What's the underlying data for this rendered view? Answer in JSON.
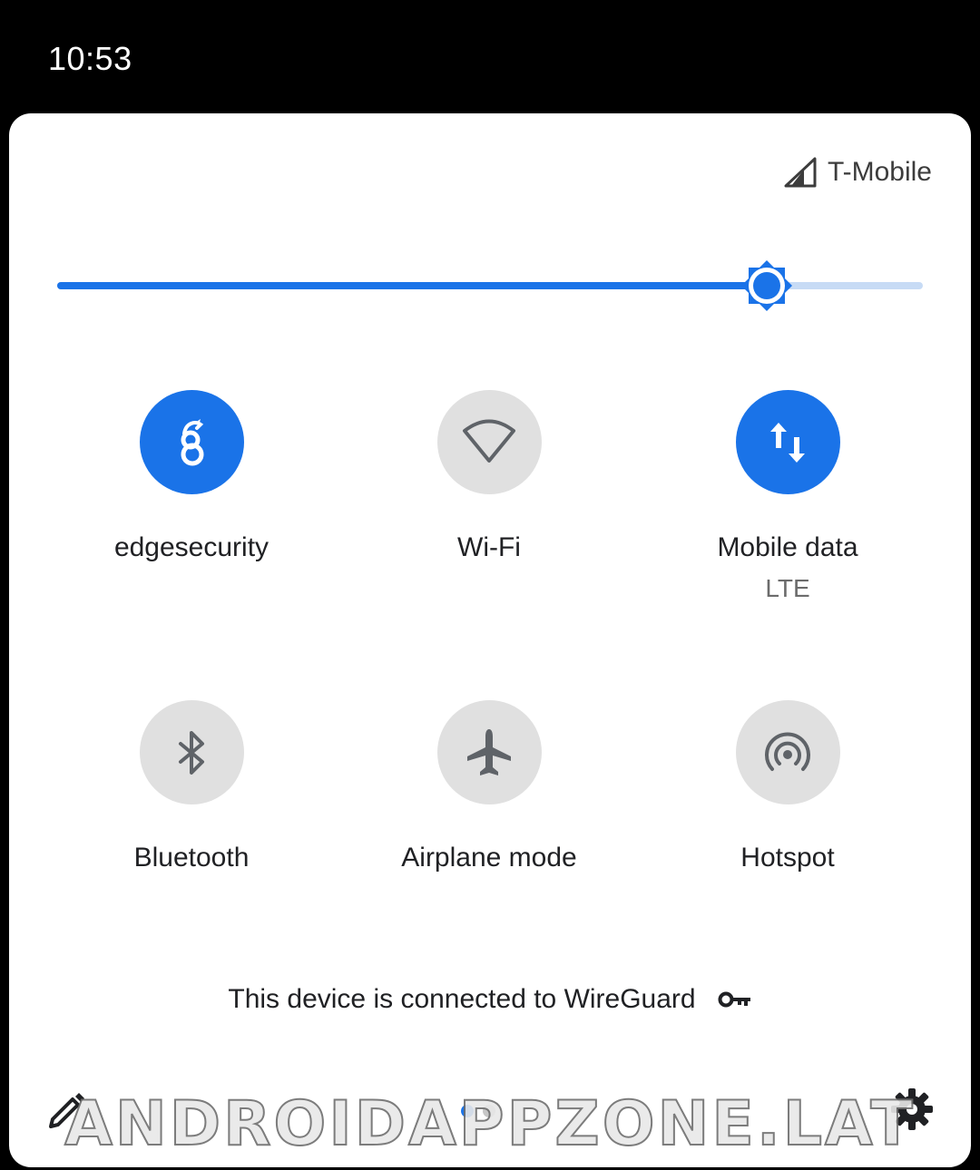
{
  "status_bar": {
    "time": "10:53"
  },
  "panel": {
    "carrier": "T-Mobile",
    "brightness": {
      "level_fraction": 0.82
    }
  },
  "tiles": [
    {
      "label": "edgesecurity",
      "state": "on",
      "icon": "wireguard-icon"
    },
    {
      "label": "Wi-Fi",
      "state": "off",
      "icon": "wifi-icon"
    },
    {
      "label": "Mobile data",
      "sublabel": "LTE",
      "state": "on",
      "icon": "mobile-data-icon"
    },
    {
      "label": "Bluetooth",
      "state": "off",
      "icon": "bluetooth-icon"
    },
    {
      "label": "Airplane mode",
      "state": "off",
      "icon": "airplane-icon"
    },
    {
      "label": "Hotspot",
      "state": "off",
      "icon": "hotspot-icon"
    }
  ],
  "footer": {
    "vpn_text": "This device is connected to WireGuard",
    "page_count": 2,
    "current_page": 1
  },
  "colors": {
    "accent": "#1a73e8",
    "tile_off": "#e0e0e0",
    "panel_bg": "#ffffff"
  },
  "watermark": "ANDROIDAPPZONE.LAT"
}
